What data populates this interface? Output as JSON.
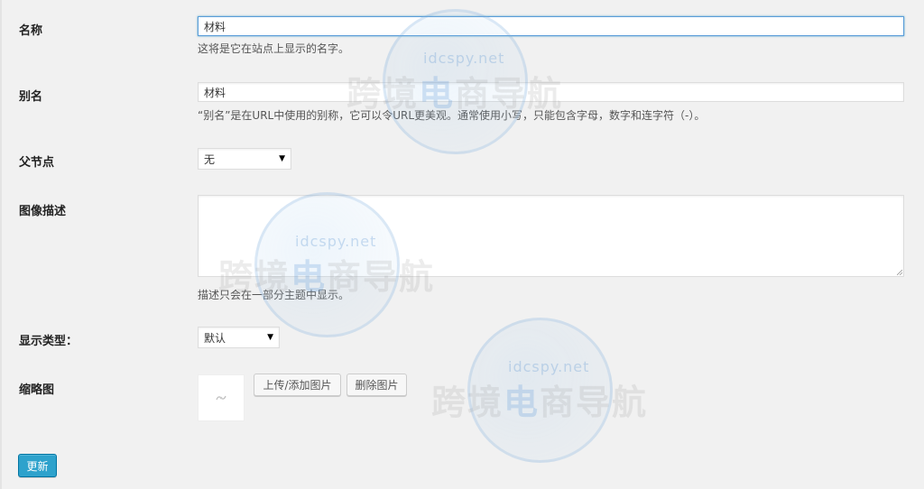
{
  "form": {
    "name": {
      "label": "名称",
      "value": "材料",
      "description": "这将是它在站点上显示的名字。"
    },
    "slug": {
      "label": "别名",
      "value": "材料",
      "description": "“别名”是在URL中使用的别称，它可以令URL更美观。通常使用小写，只能包含字母，数字和连字符（-）。"
    },
    "parent": {
      "label": "父节点",
      "selected": "无"
    },
    "image_description": {
      "label": "图像描述",
      "value": "",
      "description": "描述只会在一部分主题中显示。"
    },
    "display_type": {
      "label": "显示类型：",
      "selected": "默认"
    },
    "thumbnail": {
      "label": "缩略图",
      "upload_label": "上传/添加图片",
      "remove_label": "删除图片"
    },
    "submit_label": "更新"
  },
  "watermark": {
    "domain": "idcspy.net",
    "brand_part1": "跨境",
    "brand_highlight": "电",
    "brand_part2": "商导航"
  },
  "colors": {
    "accent": "#2ea2cc",
    "focus": "#5b9dd9",
    "background": "#f1f1f1"
  }
}
